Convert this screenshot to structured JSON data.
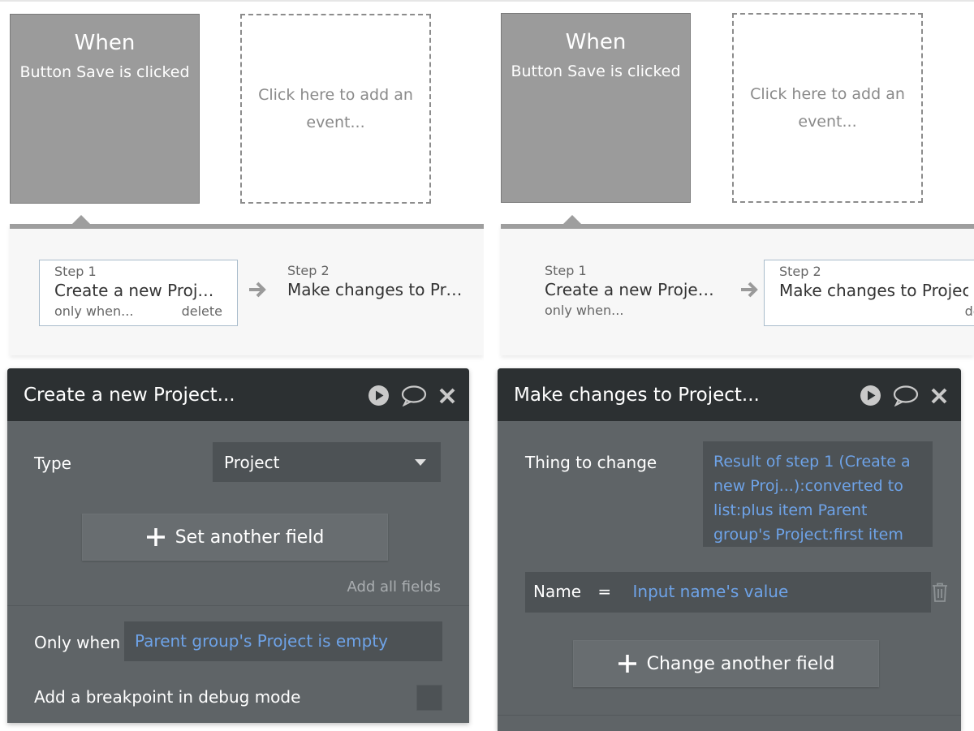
{
  "left": {
    "event_card": {
      "title": "When",
      "subtitle": "Button Save is clicked"
    },
    "add_event": "Click here to add an event...",
    "steps": [
      {
        "number": "Step 1",
        "title": "Create a new Project...",
        "condition": "only when...",
        "delete": "delete"
      },
      {
        "number": "Step 2",
        "title": "Make changes to Project..."
      }
    ],
    "panel": {
      "title": "Create a new Project...",
      "type_label": "Type",
      "type_value": "Project",
      "set_field_button": "Set another field",
      "add_all_fields": "Add all fields",
      "only_when_label": "Only when",
      "only_when_value": "Parent group's Project is empty",
      "breakpoint_label": "Add a breakpoint in debug mode"
    }
  },
  "right": {
    "event_card": {
      "title": "When",
      "subtitle": "Button Save is clicked"
    },
    "add_event": "Click here to add an event...",
    "steps": [
      {
        "number": "Step 1",
        "title": "Create a new Project...",
        "condition": "only when..."
      },
      {
        "number": "Step 2",
        "title": "Make changes to Project...",
        "delete": "delete"
      }
    ],
    "panel": {
      "title": "Make changes to Project...",
      "thing_label": "Thing to change",
      "thing_value": "Result of step 1 (Create a new Proj...):converted to list:plus item Parent group's Project:first item",
      "name_label": "Name",
      "equals": "=",
      "name_value": "Input name's value",
      "change_field_button": "Change another field"
    }
  },
  "icons": [
    "play-icon",
    "comment-icon",
    "close-icon",
    "plus-icon",
    "chevron-down-icon",
    "arrow-right-icon",
    "trash-icon"
  ],
  "colors": {
    "event_card": "#9b9b9b",
    "panel_header": "#2c3032",
    "panel_body": "#5f6467",
    "link_blue": "#6ea3e8"
  }
}
